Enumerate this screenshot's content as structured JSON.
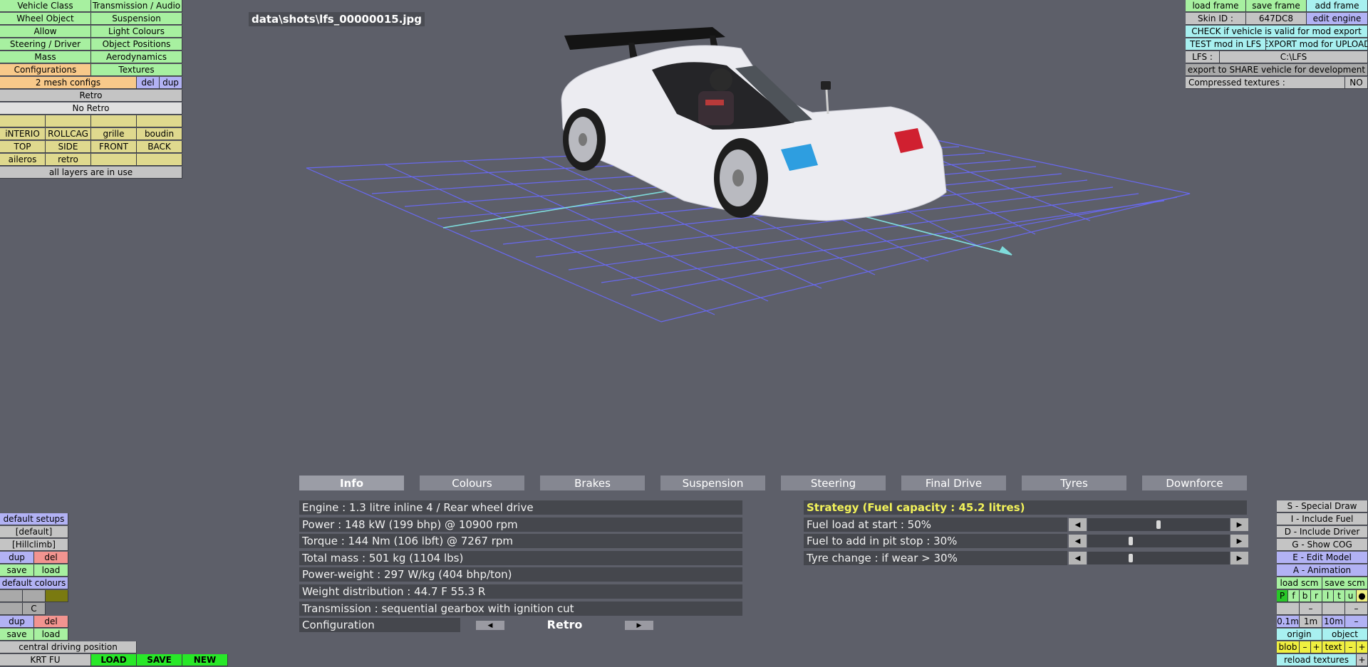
{
  "filename": "data\\shots\\lfs_00000015.jpg",
  "left_menu": {
    "col1": [
      "Vehicle Class",
      "Wheel Object",
      "Allow",
      "Steering / Driver",
      "Mass",
      "Configurations"
    ],
    "col2": [
      "Transmission / Audio",
      "Suspension",
      "Light Colours",
      "Object Positions",
      "Aerodynamics",
      "Textures"
    ],
    "mesh_configs": "2 mesh configs",
    "del": "del",
    "dup": "dup",
    "config_options": [
      "Retro",
      "No Retro"
    ],
    "layers": [
      "iNTERIO",
      "ROLLCAG",
      "grille",
      "boudin",
      "TOP",
      "SIDE",
      "FRONT",
      "BACK",
      "aileros",
      "retro"
    ],
    "layers_status": "all layers are in use"
  },
  "top_right": {
    "load_frame": "load frame",
    "save_frame": "save frame",
    "add_frame": "add frame",
    "skin_id_label": "Skin ID :",
    "skin_id_value": "647DC8",
    "edit_engine": "edit engine",
    "check_valid": "CHECK if vehicle is valid for mod export",
    "test_mod": "TEST mod in LFS",
    "export_mod": "EXPORT mod for UPLOAD",
    "lfs_label": "LFS :",
    "lfs_path": "C:\\LFS",
    "export_share": "export to SHARE vehicle for development",
    "compressed_label": "Compressed textures :",
    "compressed_value": "NO"
  },
  "tabs": [
    "Info",
    "Colours",
    "Brakes",
    "Suspension",
    "Steering",
    "Final Drive",
    "Tyres",
    "Downforce"
  ],
  "info": [
    "Engine : 1.3 litre inline 4 / Rear wheel drive",
    "Power : 148 kW (199 bhp) @ 10900 rpm",
    "Torque : 144 Nm (106 lbft) @ 7267 rpm",
    "Total mass : 501 kg (1104 lbs)",
    "Power-weight : 297 W/kg (404 bhp/ton)",
    "Weight distribution : 44.7 F  55.3 R",
    "Transmission : sequential gearbox with ignition cut"
  ],
  "configuration_label": "Configuration",
  "configuration_value": "Retro",
  "strategy": {
    "title": "Strategy (Fuel capacity : 45.2 litres)",
    "rows": [
      {
        "label": "Fuel load at start : 50%",
        "level": 0.5
      },
      {
        "label": "Fuel to add in pit stop : 30%",
        "level": 0.3
      },
      {
        "label": "Tyre change : if wear > 30%",
        "level": 0.3
      }
    ]
  },
  "left_bottom": {
    "default_setups": "default setups",
    "default": "[default]",
    "hillclimb": "[Hillclimb]",
    "dup": "dup",
    "del": "del",
    "save": "save",
    "load": "load",
    "default_colours": "default colours",
    "c": "C",
    "central_driving": "central driving position",
    "krt": "KRT FU",
    "load_big": "LOAD",
    "save_big": "SAVE",
    "new_big": "NEW"
  },
  "right_bottom": {
    "special_draw": "S - Special Draw",
    "include_fuel": "I - Include Fuel",
    "include_driver": "D - Include Driver",
    "show_cog": "G - Show COG",
    "edit_model": "E - Edit Model",
    "animation": "A - Animation",
    "load_scm": "load scm",
    "save_scm": "save scm",
    "letters": [
      "P",
      "f",
      "b",
      "r",
      "l",
      "t",
      "u",
      "●"
    ],
    "minus": "–",
    "plus": "+",
    "scale_01": "0.1m",
    "scale_1": "1m",
    "scale_10": "10m",
    "origin": "origin",
    "object": "object",
    "blob": "blob",
    "text": "text",
    "reload_textures": "reload textures"
  },
  "colors": {
    "background": "#5d5f69",
    "green_button": "#a7f0a0",
    "blue_button": "#b2b2f4",
    "yellow_text": "#f2f25a",
    "grid": "#6a6aff",
    "axis": "#7fdcdc"
  }
}
